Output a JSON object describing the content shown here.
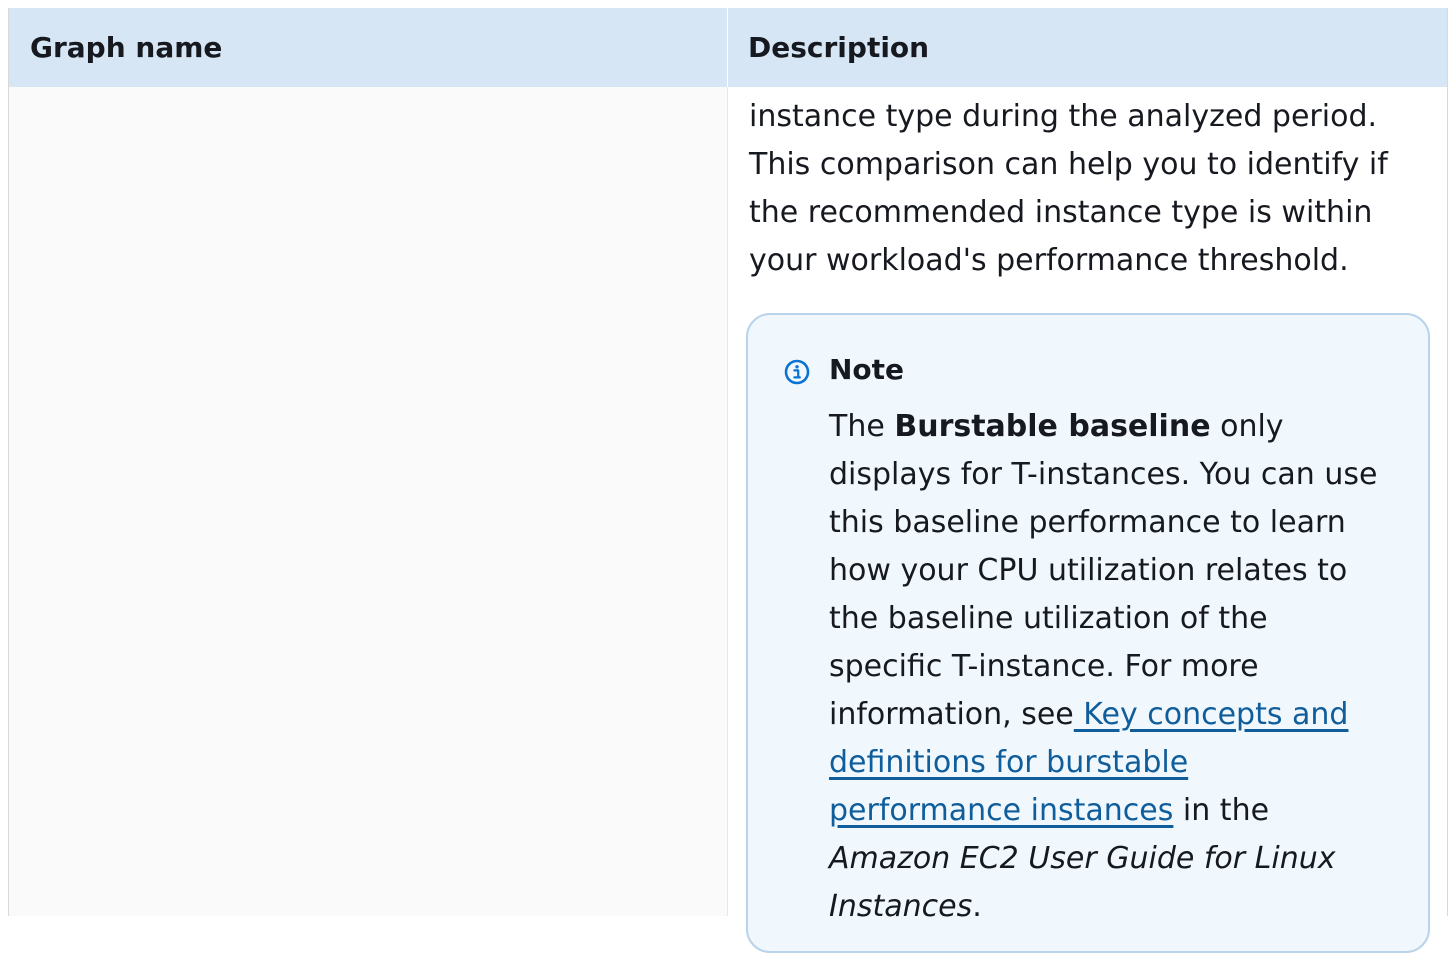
{
  "table": {
    "header": {
      "graph_name": "Graph name",
      "description": "Description"
    },
    "row": {
      "description_text": "instance type during the analyzed period. This comparison can help you to identify if the recommended instance type is within your workload's performance threshold.",
      "note": {
        "icon": "info-circle-icon",
        "title": "Note",
        "text_1": "The ",
        "bold_term": "Burstable baseline",
        "text_2": " only displays for T-instances. You can use this baseline performance to learn how your CPU utilization relates to the baseline utilization of the specific T-instance. For more information, see",
        "link_text": " Key concepts and definitions for burstable performance instances",
        "text_3": " in the ",
        "guide_title": "Amazon EC2 User Guide for Linux Instances",
        "text_4": "."
      }
    }
  },
  "colors": {
    "header_bg": "#d6e6f5",
    "note_bg": "#f1f8fd",
    "note_border": "#b9d3ea",
    "link": "#0f5d9b",
    "icon": "#0972d3"
  }
}
